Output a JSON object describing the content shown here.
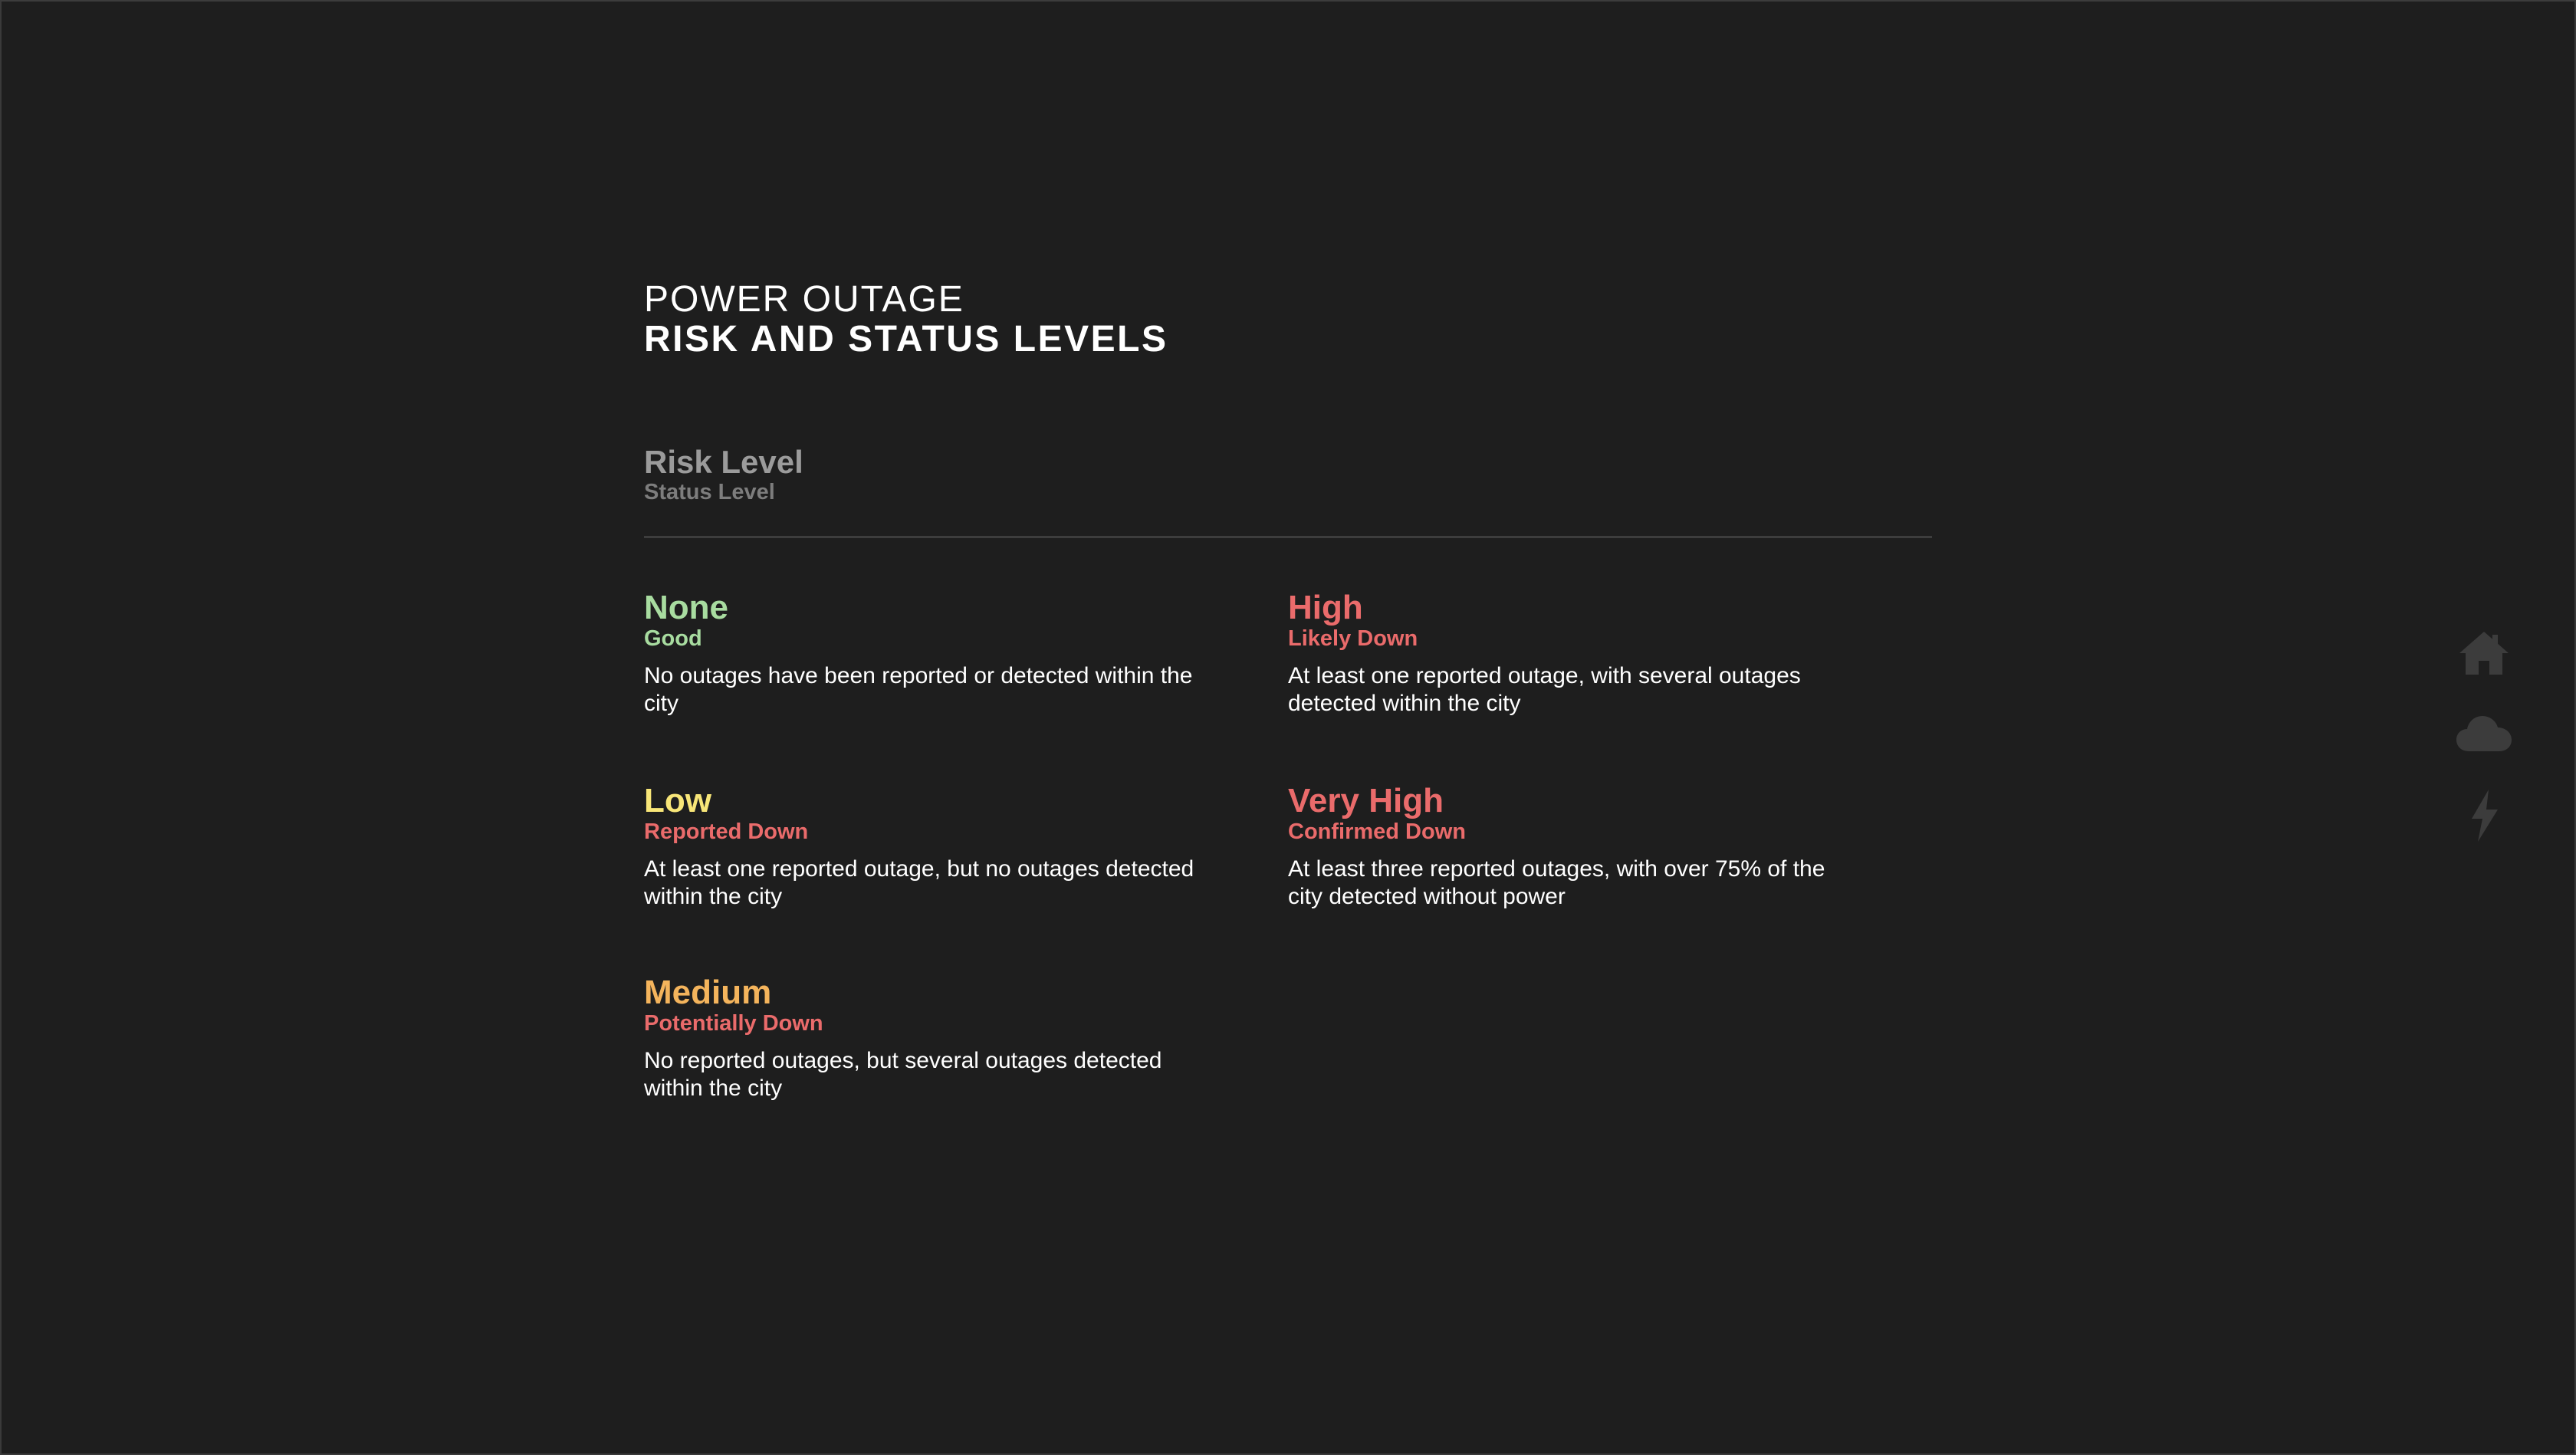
{
  "header": {
    "title_line1": "POWER OUTAGE",
    "title_line2": "RISK AND STATUS LEVELS"
  },
  "legend": {
    "risk_label": "Risk Level",
    "status_label": "Status Level"
  },
  "levels": [
    {
      "risk": "None",
      "status": "Good",
      "description": "No outages have been reported or detected within the city",
      "risk_color": "#a8dca0",
      "status_color": "#a8dca0"
    },
    {
      "risk": "Low",
      "status": "Reported Down",
      "description": "At least one reported outage, but no outages detected within the city",
      "risk_color": "#f8e678",
      "status_color": "#ea6b6b"
    },
    {
      "risk": "Medium",
      "status": "Potentially Down",
      "description": "No reported outages, but several outages detected within the city",
      "risk_color": "#f4b45c",
      "status_color": "#ea6b6b"
    },
    {
      "risk": "High",
      "status": "Likely Down",
      "description": "At least one reported outage, with several outages detected within the city",
      "risk_color": "#ea6b6b",
      "status_color": "#ea6b6b"
    },
    {
      "risk": "Very High",
      "status": "Confirmed Down",
      "description": "At least three reported outages, with over 75% of the city detected without power",
      "risk_color": "#ea6b6b",
      "status_color": "#ea6b6b"
    }
  ],
  "side_nav": {
    "icons": [
      "home-icon",
      "cloud-icon",
      "lightning-icon"
    ],
    "icon_color": "#3c3c3c"
  },
  "colors": {
    "background": "#1e1e1e",
    "divider": "#3d3d3d"
  }
}
